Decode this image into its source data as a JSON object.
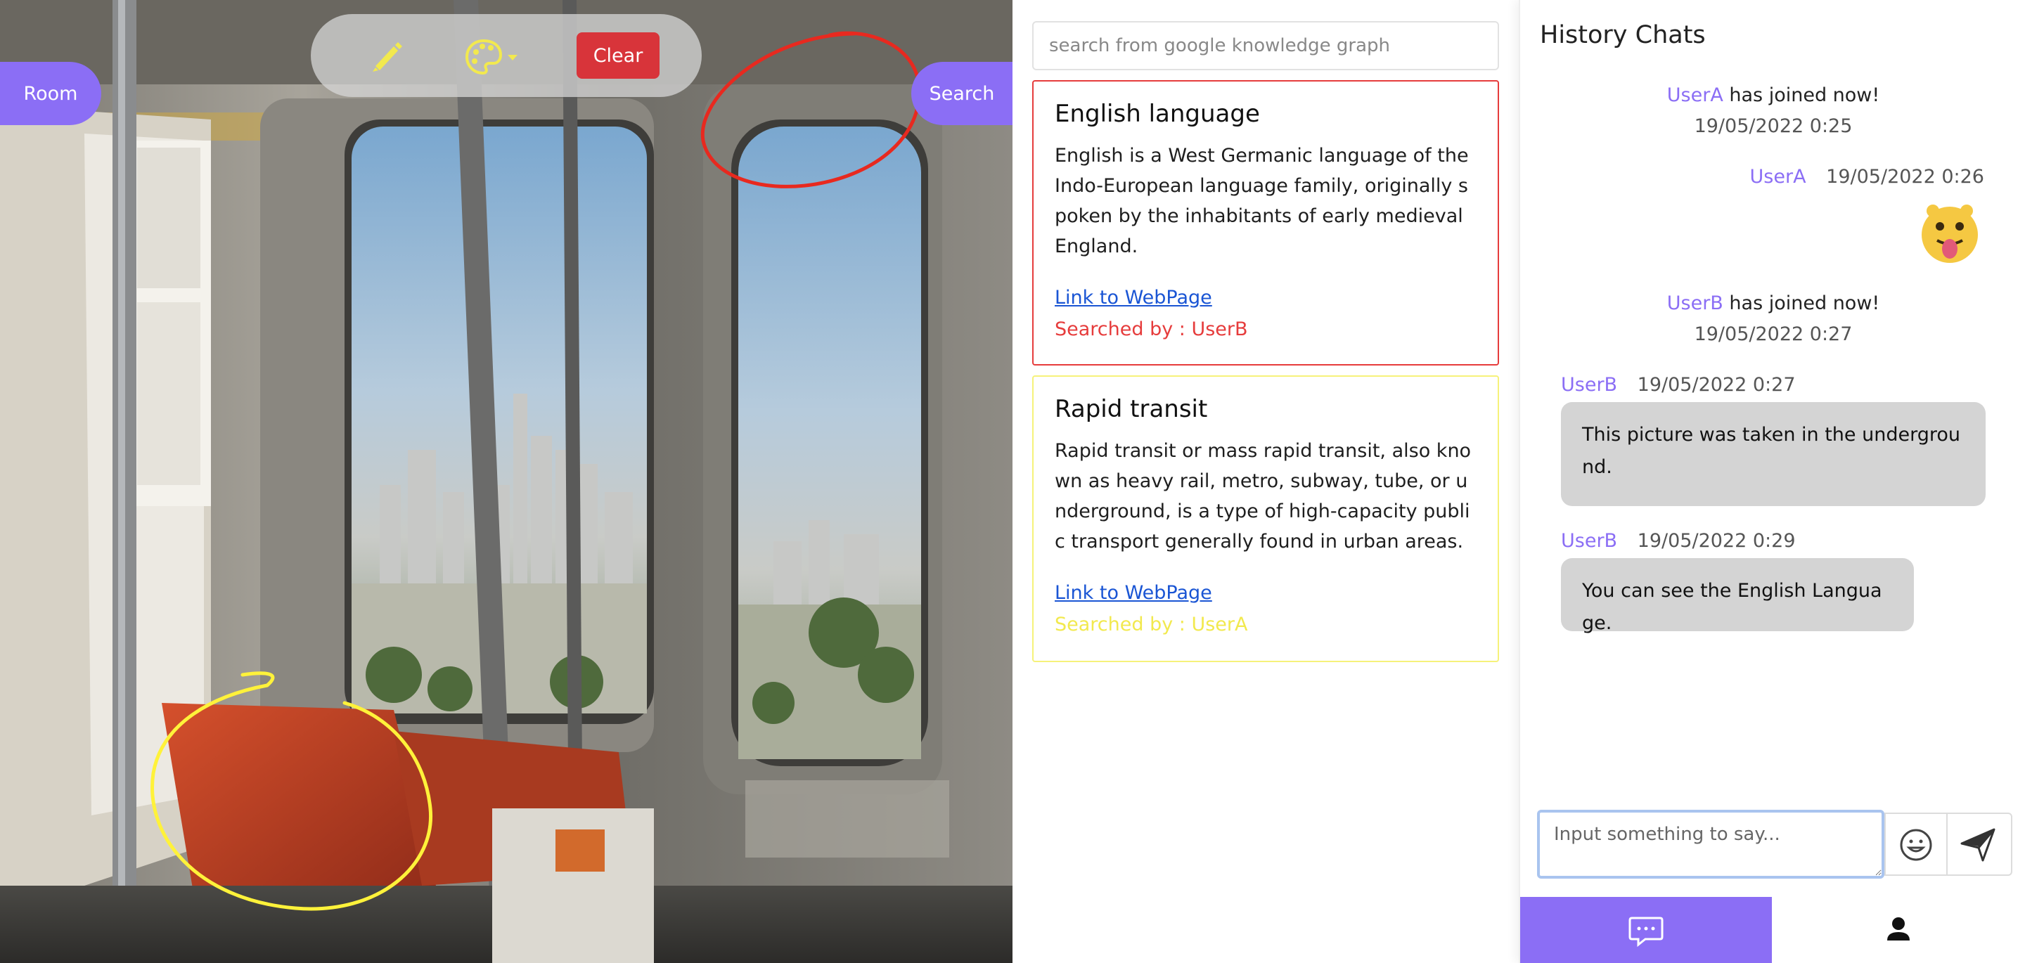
{
  "canvas": {
    "toolbar": {
      "pencil_icon": "pencil-icon",
      "palette_icon": "palette-icon",
      "clear_label": "Clear",
      "accent_color": "#f2e94e"
    },
    "room_label": "Room",
    "search_label": "Search",
    "annotation_colors": [
      "#e8291f",
      "#fff23a"
    ]
  },
  "knowledge": {
    "search_placeholder": "search from google knowledge graph",
    "cards": [
      {
        "title": "English language",
        "description": "English is a West Germanic language of the Indo-European language family, originally spoken by the inhabitants of early medieval England.",
        "link": "Link to WebPage",
        "searched_by": "Searched by : UserB",
        "color": "#e63c3c"
      },
      {
        "title": "Rapid transit",
        "description": "Rapid transit or mass rapid transit, also known as heavy rail, metro, subway, tube, or underground, is a type of high-capacity public transport generally found in urban areas.",
        "link": "Link to WebPage",
        "searched_by": "Searched by : UserA",
        "color": "#f6f27a"
      }
    ]
  },
  "chat": {
    "title": "History Chats",
    "messages": [
      {
        "type": "system",
        "user": "UserA",
        "text": "has joined now!",
        "time": "19/05/2022 0:25"
      },
      {
        "type": "sticker",
        "user": "UserA",
        "time": "19/05/2022 0:26",
        "icon": "tongue-face-sticker-icon"
      },
      {
        "type": "system",
        "user": "UserB",
        "text": "has joined now!",
        "time": "19/05/2022 0:27"
      },
      {
        "type": "text",
        "user": "UserB",
        "time": "19/05/2022 0:27",
        "text": "This picture was taken in the underground."
      },
      {
        "type": "text",
        "user": "UserB",
        "time": "19/05/2022 0:29",
        "text": "You can see the English Language."
      }
    ],
    "input_placeholder": "Input something to say...",
    "emoji_icon": "smiley-icon",
    "send_icon": "send-icon",
    "tabs": [
      {
        "icon": "chat-bubble-icon",
        "active": true
      },
      {
        "icon": "person-icon",
        "active": false
      }
    ],
    "accent_color": "#8b6ef5"
  }
}
